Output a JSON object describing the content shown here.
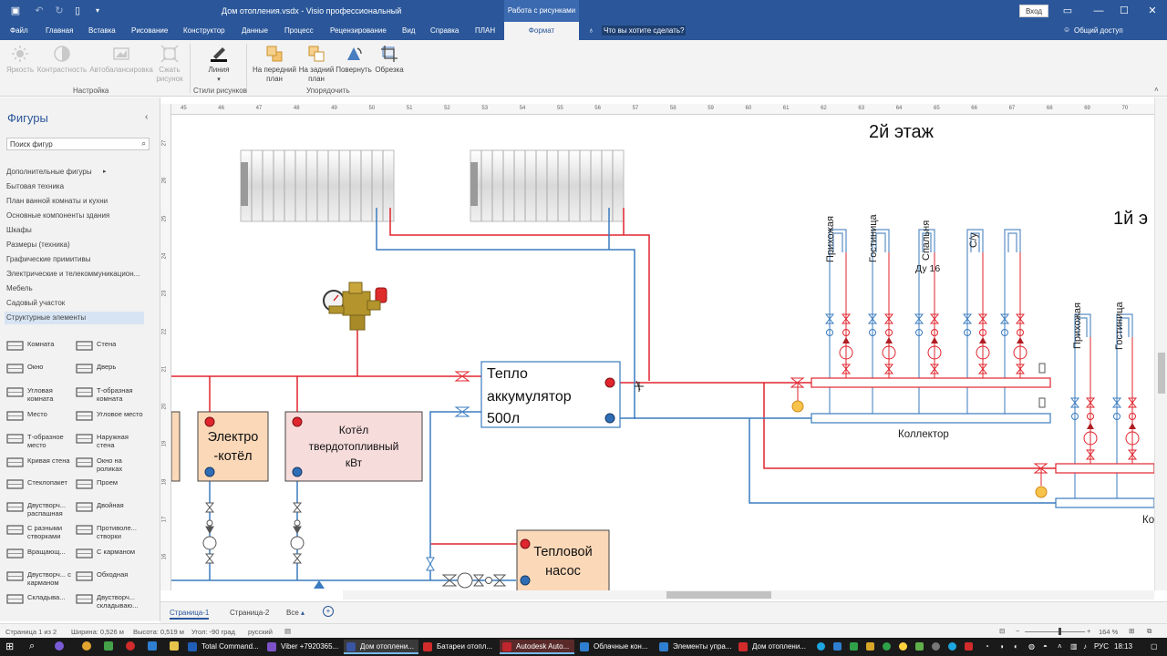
{
  "titlebar": {
    "doc_title": "Дом отопления.vsdx  -  Visio профессиональный",
    "context_tab": "Работа с рисунками",
    "signin": "Вход"
  },
  "tabs": [
    "Файл",
    "Главная",
    "Вставка",
    "Рисование",
    "Конструктор",
    "Данные",
    "Процесс",
    "Рецензирование",
    "Вид",
    "Справка",
    "ПЛАН"
  ],
  "active_tab": "Формат",
  "tell_me": "Что вы хотите сделать?",
  "share": "Общий доступ",
  "ribbon": {
    "buttons": {
      "brightness": "Яркость",
      "contrast": "Контрастность",
      "autobalance": "Автобалансировка",
      "compress1": "Сжать",
      "compress2": "рисунок",
      "line": "Линия",
      "front1": "На передний",
      "front2": "план",
      "back1": "На задний",
      "back2": "план",
      "rotate": "Повернуть",
      "crop": "Обрезка"
    },
    "groups": {
      "adjust": "Настройка",
      "picture_styles": "Стили рисунков",
      "arrange": "Упорядочить"
    }
  },
  "shapes_panel": {
    "title": "Фигуры",
    "search_placeholder": "Поиск фигур",
    "stencils": [
      "Дополнительные фигуры",
      "Бытовая техника",
      "План ванной комнаты и кухни",
      "Основные компоненты здания",
      "Шкафы",
      "Размеры (техника)",
      "Графические примитивы",
      "Электрические и телекоммуникацион...",
      "Мебель",
      "Садовый участок",
      "Структурные элементы"
    ],
    "shapes": [
      [
        "Комната",
        "Стена"
      ],
      [
        "Окно",
        "Дверь"
      ],
      [
        "Угловая комната",
        "Т-образная комната"
      ],
      [
        "Место",
        "Угловое место"
      ],
      [
        "Т-образное место",
        "Наружная стена"
      ],
      [
        "Кривая стена",
        "Окно на роликах"
      ],
      [
        "Стеклопакет",
        "Проем"
      ],
      [
        "Двустворч... распашная",
        "Двойная"
      ],
      [
        "С разными створками",
        "Противоле... створки"
      ],
      [
        "Вращающ...",
        "С карманом"
      ],
      [
        "Двустворч... с карманом",
        "Обходная"
      ],
      [
        "Складыва...",
        "Двустворч... складываю..."
      ]
    ]
  },
  "ruler": {
    "h": [
      "45",
      "46",
      "47",
      "48",
      "49",
      "50",
      "51",
      "52",
      "53",
      "54",
      "55",
      "56",
      "57",
      "58",
      "59",
      "60",
      "61",
      "62",
      "63",
      "64",
      "65",
      "66",
      "67",
      "68",
      "69",
      "70"
    ],
    "v": [
      "27",
      "26",
      "25",
      "24",
      "23",
      "22",
      "21",
      "20",
      "19",
      "18",
      "17",
      "16"
    ]
  },
  "diagram": {
    "floor2": "2й этаж",
    "floor1": "1й э",
    "rooms2": [
      "Прихожая",
      "Гостиница",
      "Спальня",
      "С/у"
    ],
    "rooms1": [
      "Прихожая",
      "Гостиница"
    ],
    "du": "Ду 16",
    "collector": "Коллектор",
    "collector1": "Ко",
    "tank": [
      "Тепло",
      "аккумулятор",
      "500л"
    ],
    "electro": [
      "Электро",
      "-котёл"
    ],
    "boiler": [
      "Котёл",
      "твердотопливный",
      "кВт"
    ],
    "pump": [
      "Тепловой",
      "насос"
    ]
  },
  "pages": {
    "page1": "Страница-1",
    "page2": "Страница-2",
    "all": "Все"
  },
  "status": {
    "page": "Страница 1 из 2",
    "width": "Ширина: 0,526 м",
    "height": "Высота: 0,519 м",
    "angle": "Угол: -90 град",
    "lang": "русский",
    "zoom": "164 %"
  },
  "taskbar": {
    "apps": [
      "Total Command...",
      "Viber +7920365...",
      "Дом отоплени...",
      "Батареи отопл...",
      "Autodesk Auto...",
      "Облачные кон...",
      "Элементы упра...",
      "Дом отоплени..."
    ],
    "lang": "РУС",
    "time": "18:13"
  },
  "colors": {
    "brand": "#2b579a",
    "hot_pipe": "#e0252e",
    "cold_pipe": "#3a7bbf",
    "block_fill": "#fbd8b8"
  }
}
